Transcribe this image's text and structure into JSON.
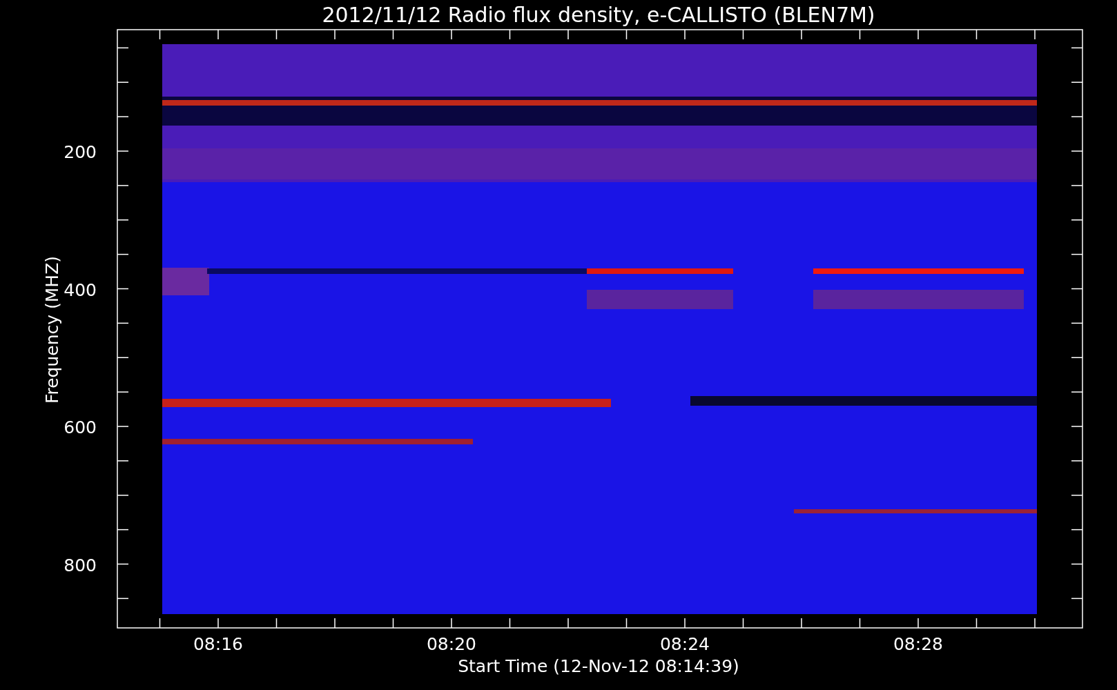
{
  "title": "2012/11/12  Radio flux density, e-CALLISTO (BLEN7M)",
  "y_axis": {
    "label": "Frequency (MHZ)",
    "ticks": [
      "200",
      "400",
      "600",
      "800"
    ]
  },
  "x_axis": {
    "label": "Start Time (12-Nov-12 08:14:39)",
    "ticks": [
      "08:16",
      "08:20",
      "08:24",
      "08:28"
    ]
  }
}
